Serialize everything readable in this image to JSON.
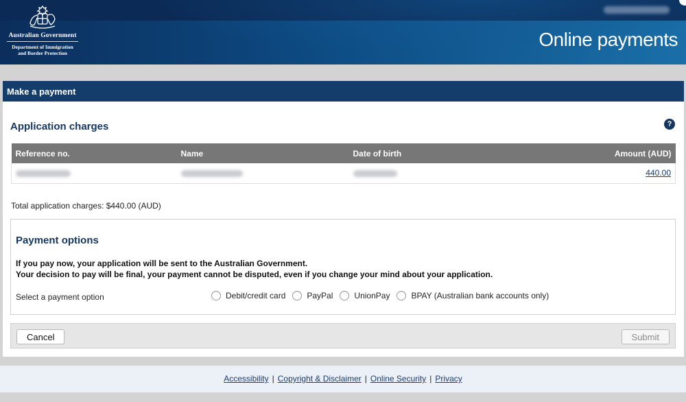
{
  "header": {
    "gov_name": "Australian Government",
    "dept_line1": "Department of Immigration",
    "dept_line2": "and Border Protection",
    "title": "Online payments"
  },
  "panel": {
    "title": "Make a payment"
  },
  "charges": {
    "title": "Application charges",
    "help_glyph": "?",
    "columns": {
      "reference": "Reference no.",
      "name": "Name",
      "dob": "Date of birth",
      "amount": "Amount (AUD)"
    },
    "rows": [
      {
        "amount": "440.00"
      }
    ],
    "total_label": "Total application charges: $440.00 (AUD)"
  },
  "payment": {
    "title": "Payment options",
    "warning_line1": "If you pay now, your application will be sent to the Australian Government.",
    "warning_line2": "Your decision to pay will be final, your payment cannot be disputed, even if you change your mind about your application.",
    "select_label": "Select a payment option",
    "options": [
      "Debit/credit card",
      "PayPal",
      "UnionPay",
      "BPAY (Australian bank accounts only)"
    ]
  },
  "actions": {
    "cancel": "Cancel",
    "submit": "Submit"
  },
  "footer": {
    "links": [
      "Accessibility",
      "Copyright & Disclaimer",
      "Online Security",
      "Privacy"
    ],
    "separator": "|"
  },
  "colors": {
    "header_dark": "#0b2e5c",
    "panel_head": "#143d6b",
    "section_title": "#14365f",
    "table_head": "#777777",
    "footer_bg": "#ecf1f8"
  }
}
